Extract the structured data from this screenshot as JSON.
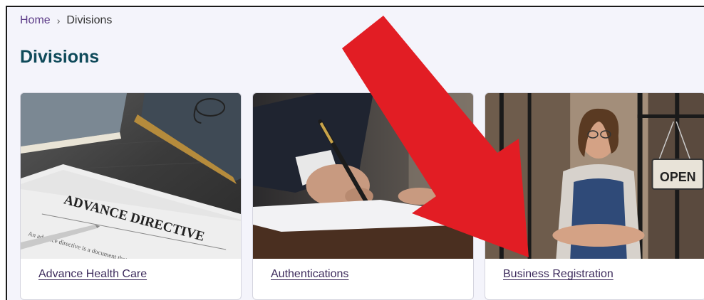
{
  "breadcrumb": {
    "home": "Home",
    "separator": "›",
    "current": "Divisions"
  },
  "page": {
    "title": "Divisions"
  },
  "cards": [
    {
      "label": "Advance Health Care",
      "image_text": "ADVANCE DIRECTIVE",
      "image_small_text": "An advance directive is a document that allows you to make decisions if they are unable... Depending..."
    },
    {
      "label": "Authentications"
    },
    {
      "label": "Business Registration",
      "image_sign_text": "OPEN"
    }
  ],
  "colors": {
    "title": "#0f4a5a",
    "link": "#5b3a87",
    "arrow": "#e21d24",
    "background": "#f4f4fb"
  },
  "icons": {
    "breadcrumb_separator": "chevron-right-icon",
    "annotation": "red-arrow-icon"
  }
}
